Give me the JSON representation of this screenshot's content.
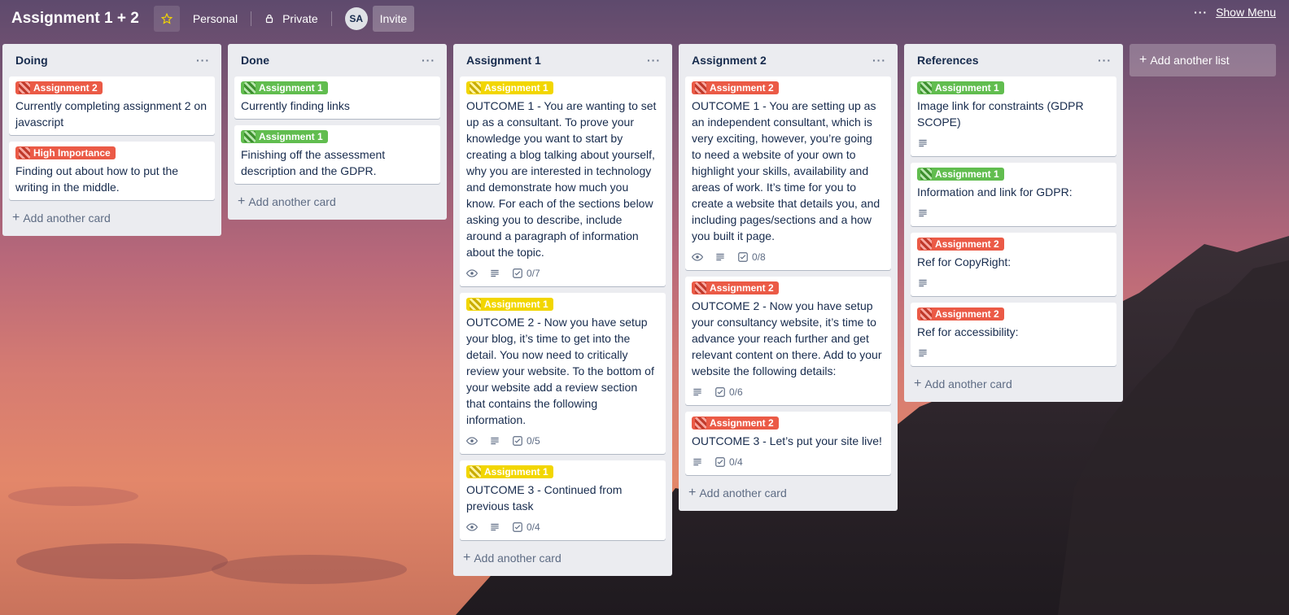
{
  "header": {
    "board_title": "Assignment 1 + 2",
    "personal": "Personal",
    "private": "Private",
    "avatar_initials": "SA",
    "invite": "Invite",
    "show_menu": "Show Menu"
  },
  "add_another_list": "Add another list",
  "add_another_card": "Add another card",
  "colors": {
    "red": "#eb5a46",
    "green": "#61bd4f",
    "yellow": "#f2d600"
  },
  "lists": [
    {
      "title": "Doing",
      "cards": [
        {
          "label": "Assignment 2",
          "label_color": "red",
          "text": "Currently completing assignment 2 on javascript"
        },
        {
          "label": "High Importance",
          "label_color": "red",
          "text": "Finding out about how to put the writing in the middle."
        }
      ]
    },
    {
      "title": "Done",
      "cards": [
        {
          "label": "Assignment 1",
          "label_color": "green",
          "text": "Currently finding links"
        },
        {
          "label": "Assignment 1",
          "label_color": "green",
          "text": "Finishing off the assessment description and the GDPR."
        }
      ]
    },
    {
      "title": "Assignment 1",
      "cards": [
        {
          "label": "Assignment 1",
          "label_color": "yellow",
          "text": "OUTCOME 1 - You are wanting to set up as a consultant. To prove your knowledge you want to start by creating a blog talking about yourself, why you are interested in technology and demonstrate how much you know. For each of the sections below asking you to describe, include around a paragraph of information about the topic.",
          "checklist": "0/7"
        },
        {
          "label": "Assignment 1",
          "label_color": "yellow",
          "text": "OUTCOME 2 - Now you have setup your blog, it’s time to get into the detail. You now need to critically review your website. To the bottom of your website add a review section that contains the following information.",
          "checklist": "0/5"
        },
        {
          "label": "Assignment 1",
          "label_color": "yellow",
          "text": "OUTCOME 3 - Continued from previous task",
          "checklist": "0/4"
        }
      ]
    },
    {
      "title": "Assignment 2",
      "cards": [
        {
          "label": "Assignment 2",
          "label_color": "red",
          "text": "OUTCOME 1 - You are setting up as an independent consultant, which is very exciting, however, you’re going to need a website of your own to highlight your skills, availability and areas of work. It’s time for you to create a website that details you, and including pages/sections and a how you built it page.",
          "checklist": "0/8"
        },
        {
          "label": "Assignment 2",
          "label_color": "red",
          "text": "OUTCOME 2 - Now you have setup your consultancy website, it’s time to advance your reach further and get relevant content on there. Add to your website the following details:",
          "checklist": "0/6"
        },
        {
          "label": "Assignment 2",
          "label_color": "red",
          "text": "OUTCOME 3 - Let’s put your site live!",
          "checklist": "0/4"
        }
      ]
    },
    {
      "title": "References",
      "cards": [
        {
          "label": "Assignment 1",
          "label_color": "green",
          "text": "Image link for constraints (GDPR SCOPE)"
        },
        {
          "label": "Assignment 1",
          "label_color": "green",
          "text": "Information and link for GDPR:"
        },
        {
          "label": "Assignment 2",
          "label_color": "red",
          "text": "Ref for CopyRight:"
        },
        {
          "label": "Assignment 2",
          "label_color": "red",
          "text": "Ref for accessibility:"
        }
      ]
    }
  ]
}
